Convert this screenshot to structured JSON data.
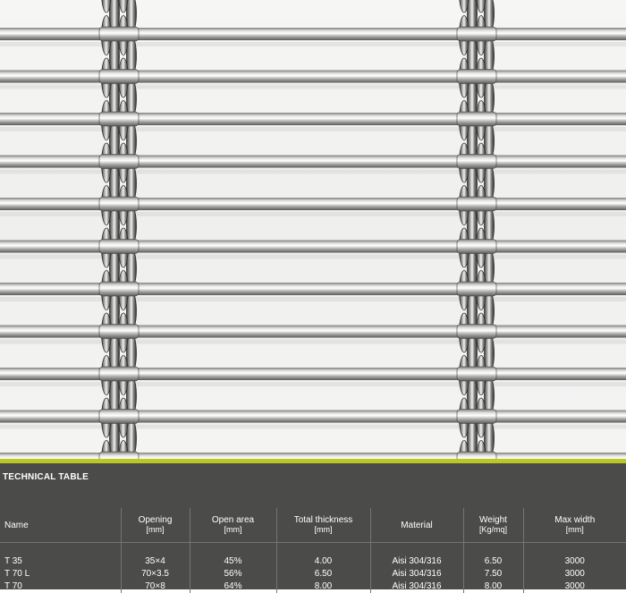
{
  "colors": {
    "accent": "#b9c822",
    "panel": "#4b4b4a",
    "text": "#ffffff"
  },
  "photo": {
    "subject": "stainless steel architectural mesh close-up"
  },
  "table": {
    "title": "TECHNICAL TABLE",
    "headers": [
      {
        "label": "Name",
        "unit": ""
      },
      {
        "label": "Opening",
        "unit": "[mm]"
      },
      {
        "label": "Open area",
        "unit": "[mm]"
      },
      {
        "label": "Total thickness",
        "unit": "[mm]"
      },
      {
        "label": "Material",
        "unit": ""
      },
      {
        "label": "Weight",
        "unit": "[Kg/mq]"
      },
      {
        "label": "Max width",
        "unit": "[mm]"
      }
    ],
    "rows": [
      [
        "T 35",
        "35×4",
        "45%",
        "4.00",
        "Aisi 304/316",
        "6.50",
        "3000"
      ],
      [
        "T 70 L",
        "70×3.5",
        "56%",
        "6.50",
        "Aisi 304/316",
        "7.50",
        "3000"
      ],
      [
        "T 70",
        "70×8",
        "64%",
        "8.00",
        "Aisi 304/316",
        "8.00",
        "3000"
      ]
    ]
  }
}
